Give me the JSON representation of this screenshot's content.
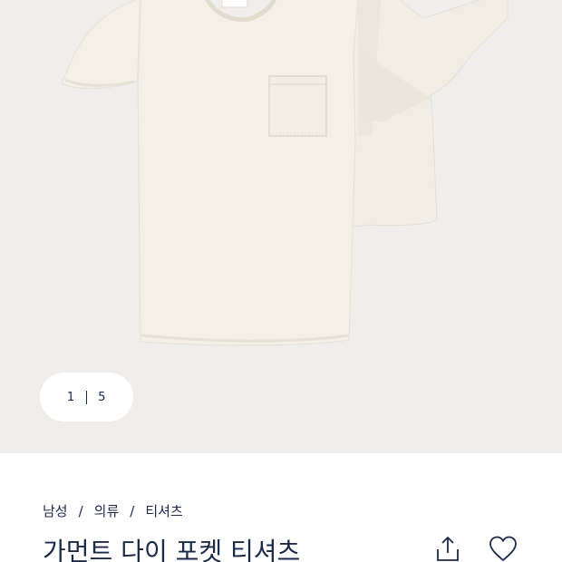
{
  "gallery": {
    "counter": {
      "current": "1",
      "total": "5"
    },
    "background_color": "#efeeed",
    "product_image": "two-cream-tshirts-with-pocket"
  },
  "breadcrumb": {
    "items": [
      {
        "label": "남성"
      },
      {
        "label": "의류"
      },
      {
        "label": "티셔츠"
      }
    ],
    "separator": "/"
  },
  "product": {
    "title": "가먼트 다이 포켓 티셔츠"
  },
  "actions": {
    "share_icon": "share-icon",
    "wishlist_icon": "heart-icon"
  },
  "colors": {
    "text": "#1c2a4a",
    "shirt": "#f3efe6"
  }
}
